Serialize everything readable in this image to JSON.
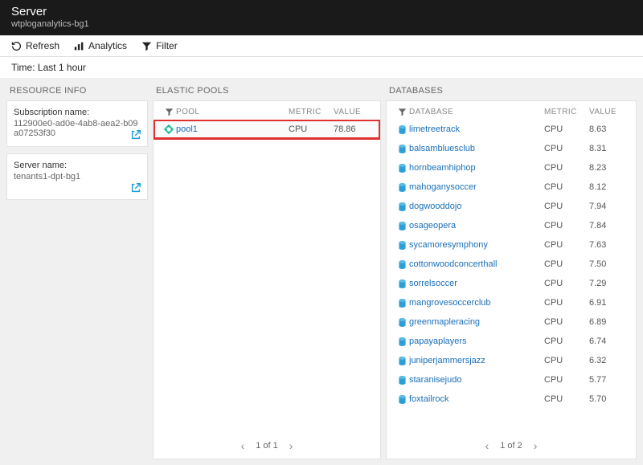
{
  "header": {
    "title": "Server",
    "subtitle": "wtploganalytics-bg1"
  },
  "toolbar": {
    "refresh": "Refresh",
    "analytics": "Analytics",
    "filter": "Filter"
  },
  "timebar": "Time: Last 1 hour",
  "sections": {
    "resource_info": "RESOURCE INFO",
    "elastic_pools": "ELASTIC POOLS",
    "databases": "DATABASES"
  },
  "resource_info": {
    "subscription_label": "Subscription name:",
    "subscription_value": "112900e0-ad0e-4ab8-aea2-b09a07253f30",
    "server_label": "Server name:",
    "server_value": "tenants1-dpt-bg1"
  },
  "table_headers": {
    "pool": "POOL",
    "database": "DATABASE",
    "metric": "METRIC",
    "value": "VALUE"
  },
  "pools": [
    {
      "name": "pool1",
      "metric": "CPU",
      "value": "78.86",
      "selected": true
    }
  ],
  "databases": [
    {
      "name": "limetreetrack",
      "metric": "CPU",
      "value": "8.63"
    },
    {
      "name": "balsambluesclub",
      "metric": "CPU",
      "value": "8.31"
    },
    {
      "name": "hornbeamhiphop",
      "metric": "CPU",
      "value": "8.23"
    },
    {
      "name": "mahoganysoccer",
      "metric": "CPU",
      "value": "8.12"
    },
    {
      "name": "dogwooddojo",
      "metric": "CPU",
      "value": "7.94"
    },
    {
      "name": "osageopera",
      "metric": "CPU",
      "value": "7.84"
    },
    {
      "name": "sycamoresymphony",
      "metric": "CPU",
      "value": "7.63"
    },
    {
      "name": "cottonwoodconcerthall",
      "metric": "CPU",
      "value": "7.50"
    },
    {
      "name": "sorrelsoccer",
      "metric": "CPU",
      "value": "7.29"
    },
    {
      "name": "mangrovesoccerclub",
      "metric": "CPU",
      "value": "6.91"
    },
    {
      "name": "greenmapleracing",
      "metric": "CPU",
      "value": "6.89"
    },
    {
      "name": "papayaplayers",
      "metric": "CPU",
      "value": "6.74"
    },
    {
      "name": "juniperjammersjazz",
      "metric": "CPU",
      "value": "6.32"
    },
    {
      "name": "staranisejudo",
      "metric": "CPU",
      "value": "5.77"
    },
    {
      "name": "foxtailrock",
      "metric": "CPU",
      "value": "5.70"
    }
  ],
  "pagers": {
    "pools": "1 of 1",
    "databases": "1 of 2"
  }
}
